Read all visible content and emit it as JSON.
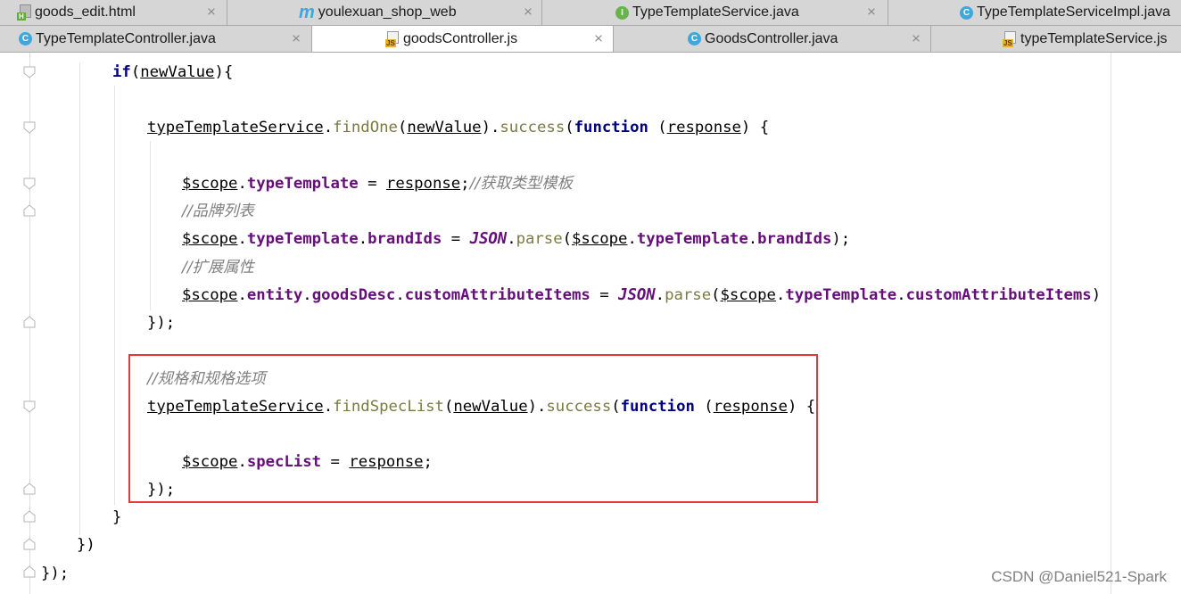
{
  "tabs_row1": [
    {
      "label": "goods_edit.html",
      "icon": "html-file-icon",
      "active": false
    },
    {
      "label": "youlexuan_shop_web",
      "icon": "module-icon",
      "active": false
    },
    {
      "label": "TypeTemplateService.java",
      "icon": "interface-icon",
      "active": false
    },
    {
      "label": "TypeTemplateServiceImpl.java",
      "icon": "class-icon",
      "active": false
    }
  ],
  "tabs_row2": [
    {
      "label": "TypeTemplateController.java",
      "icon": "class-icon",
      "active": false
    },
    {
      "label": "goodsController.js",
      "icon": "js-file-icon",
      "active": true
    },
    {
      "label": "GoodsController.java",
      "icon": "class-icon",
      "active": false
    },
    {
      "label": "typeTemplateService.js",
      "icon": "js-file-icon",
      "active": false
    }
  ],
  "code": {
    "l1": {
      "kw": "if",
      "p1": "(",
      "var": "newValue",
      "p2": "){"
    },
    "l2": {
      "svc": "typeTemplateService",
      "d1": ".",
      "fn": "findOne",
      "p1": "(",
      "arg": "newValue",
      "p2": ").",
      "succ": "success",
      "p3": "(",
      "kw": "function",
      "p4": " (",
      "resp": "response",
      "p5": ") {"
    },
    "l3": {
      "scope": "$scope",
      "d1": ".",
      "prop": "typeTemplate",
      "eq": " = ",
      "resp": "response",
      "semi": ";",
      "cmt": "//获取类型模板"
    },
    "l4": {
      "cmt": "//品牌列表"
    },
    "l5": {
      "scope": "$scope",
      "d1": ".",
      "prop1": "typeTemplate",
      "d2": ".",
      "prop2": "brandIds",
      "eq": " = ",
      "json": "JSON",
      "d3": ".",
      "fn": "parse",
      "p1": "(",
      "scope2": "$scope",
      "d4": ".",
      "prop3": "typeTemplate",
      "d5": ".",
      "prop4": "brandIds",
      "p2": ");"
    },
    "l6": {
      "cmt": "//扩展属性"
    },
    "l7": {
      "scope": "$scope",
      "d1": ".",
      "prop1": "entity",
      "d2": ".",
      "prop2": "goodsDesc",
      "d3": ".",
      "prop3": "customAttributeItems",
      "eq": " = ",
      "json": "JSON",
      "d4": ".",
      "fn": "parse",
      "p1": "(",
      "scope2": "$scope",
      "d5": ".",
      "prop4": "typeTemplate",
      "d6": ".",
      "prop5": "customAttributeItems",
      "p2": ")"
    },
    "l8": {
      "text": "});"
    },
    "l9": {
      "cmt": "//规格和规格选项"
    },
    "l10": {
      "svc": "typeTemplateService",
      "d1": ".",
      "fn": "findSpecList",
      "p1": "(",
      "arg": "newValue",
      "p2": ").",
      "succ": "success",
      "p3": "(",
      "kw": "function",
      "p4": " (",
      "resp": "response",
      "p5": ") {"
    },
    "l11": {
      "scope": "$scope",
      "d1": ".",
      "prop": "specList",
      "eq": " = ",
      "resp": "response",
      "semi": ";"
    },
    "l12": {
      "text": "});"
    },
    "l13": {
      "text": "}"
    },
    "l14": {
      "text": "})"
    },
    "l15": {
      "text": "});"
    }
  },
  "colors": {
    "keyword": "#000080",
    "property": "#660e7a",
    "method": "#7a7a43",
    "comment": "#808080",
    "highlight_box": "#e5383c"
  },
  "watermark": "CSDN @Daniel521-Spark"
}
